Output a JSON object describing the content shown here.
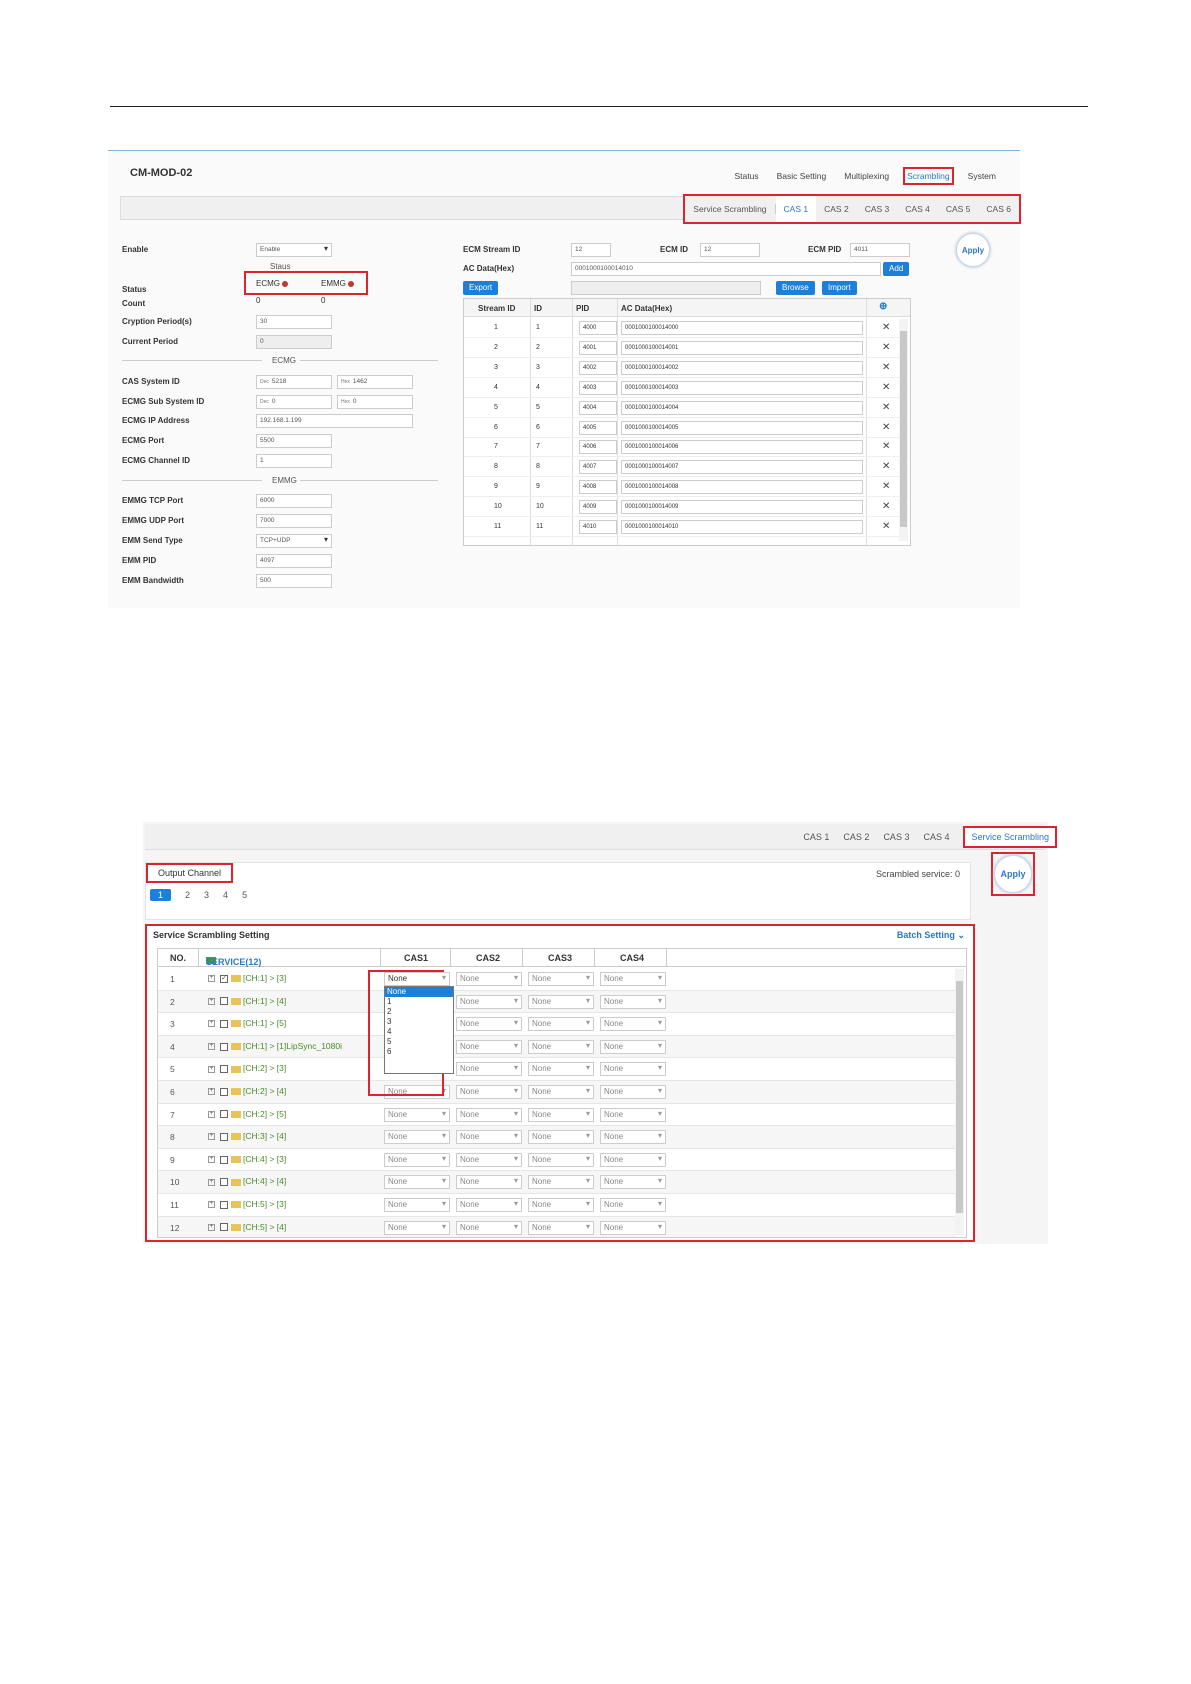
{
  "s1": {
    "title": "CM-MOD-02",
    "nav": [
      "Status",
      "Basic Setting",
      "Multiplexing",
      "Scrambling",
      "System"
    ],
    "nav_active": "Scrambling",
    "subtabs": [
      "Service Scrambling",
      "CAS 1",
      "CAS 2",
      "CAS 3",
      "CAS 4",
      "CAS 5",
      "CAS 6"
    ],
    "subtab_active": "CAS 1",
    "left": {
      "enable_label": "Enable",
      "enable_value": "Enable",
      "staus_heading": "Staus",
      "status_label": "Status",
      "ecmg": "ECMG",
      "emmg": "EMMG",
      "count_label": "Count",
      "count_ecmg": "0",
      "count_emmg": "0",
      "cryption_label": "Cryption Period(s)",
      "cryption_value": "30",
      "current_label": "Current Period",
      "current_value": "0",
      "ecmg_heading": "ECMG",
      "cas_sys_label": "CAS System ID",
      "dec_prefix": "Dec",
      "hex_prefix": "Hex",
      "cas_sys_dec": "5218",
      "cas_sys_hex": "1462",
      "ecmg_sub_label": "ECMG Sub System ID",
      "ecmg_sub_dec": "0",
      "ecmg_sub_hex": "0",
      "ecmg_ip_label": "ECMG IP Address",
      "ecmg_ip": "192.168.1.199",
      "ecmg_port_label": "ECMG Port",
      "ecmg_port": "5500",
      "ecmg_ch_label": "ECMG Channel ID",
      "ecmg_ch": "1",
      "emmg_heading": "EMMG",
      "emmg_tcp_label": "EMMG TCP Port",
      "emmg_tcp": "6000",
      "emmg_udp_label": "EMMG UDP Port",
      "emmg_udp": "7000",
      "emm_send_label": "EMM Send Type",
      "emm_send": "TCP+UDP",
      "emm_pid_label": "EMM PID",
      "emm_pid": "4097",
      "emm_bw_label": "EMM Bandwidth",
      "emm_bw": "500"
    },
    "right": {
      "ecm_stream_label": "ECM Stream ID",
      "ecm_stream": "12",
      "ecm_id_label": "ECM ID",
      "ecm_id": "12",
      "ecm_pid_label": "ECM PID",
      "ecm_pid": "4011",
      "ac_label": "AC Data(Hex)",
      "ac_value": "0001000100014010",
      "add": "Add",
      "export": "Export",
      "browse": "Browse",
      "import": "Import",
      "apply": "Apply",
      "col_stream": "Stream ID",
      "col_id": "ID",
      "col_pid": "PID",
      "col_ac": "AC Data(Hex)"
    },
    "rows": [
      {
        "sid": "1",
        "id": "1",
        "pid": "4000",
        "ac": "0001000100014000"
      },
      {
        "sid": "2",
        "id": "2",
        "pid": "4001",
        "ac": "0001000100014001"
      },
      {
        "sid": "3",
        "id": "3",
        "pid": "4002",
        "ac": "0001000100014002"
      },
      {
        "sid": "4",
        "id": "4",
        "pid": "4003",
        "ac": "0001000100014003"
      },
      {
        "sid": "5",
        "id": "5",
        "pid": "4004",
        "ac": "0001000100014004"
      },
      {
        "sid": "6",
        "id": "6",
        "pid": "4005",
        "ac": "0001000100014005"
      },
      {
        "sid": "7",
        "id": "7",
        "pid": "4006",
        "ac": "0001000100014006"
      },
      {
        "sid": "8",
        "id": "8",
        "pid": "4007",
        "ac": "0001000100014007"
      },
      {
        "sid": "9",
        "id": "9",
        "pid": "4008",
        "ac": "0001000100014008"
      },
      {
        "sid": "10",
        "id": "10",
        "pid": "4009",
        "ac": "0001000100014009"
      },
      {
        "sid": "11",
        "id": "11",
        "pid": "4010",
        "ac": "0001000100014010"
      }
    ]
  },
  "s2": {
    "tabs": [
      "CAS 1",
      "CAS 2",
      "CAS 3",
      "CAS 4"
    ],
    "active_tab": "Service Scrambling",
    "output_channel": "Output Channel",
    "pages": [
      "1",
      "2",
      "3",
      "4",
      "5"
    ],
    "scrambled": "Scrambled service: 0",
    "apply": "Apply",
    "section_title": "Service Scrambling Setting",
    "batch": "Batch Setting",
    "col_no": "NO.",
    "col_service": "SERVICE(12)",
    "cas_cols": [
      "CAS1",
      "CAS2",
      "CAS3",
      "CAS4"
    ],
    "none": "None",
    "popup_options": [
      "None",
      "1",
      "2",
      "3",
      "4",
      "5",
      "6"
    ],
    "rows": [
      {
        "no": "1",
        "name": "[CH:1] > [3]",
        "checked": true
      },
      {
        "no": "2",
        "name": "[CH:1] > [4]",
        "checked": false
      },
      {
        "no": "3",
        "name": "[CH:1] > [5]",
        "checked": false
      },
      {
        "no": "4",
        "name": "[CH:1] > [1]LipSync_1080i",
        "checked": false
      },
      {
        "no": "5",
        "name": "[CH:2] > [3]",
        "checked": false
      },
      {
        "no": "6",
        "name": "[CH:2] > [4]",
        "checked": false
      },
      {
        "no": "7",
        "name": "[CH:2] > [5]",
        "checked": false
      },
      {
        "no": "8",
        "name": "[CH:3] > [4]",
        "checked": false
      },
      {
        "no": "9",
        "name": "[CH:4] > [3]",
        "checked": false
      },
      {
        "no": "10",
        "name": "[CH:4] > [4]",
        "checked": false
      },
      {
        "no": "11",
        "name": "[CH:5] > [3]",
        "checked": false
      },
      {
        "no": "12",
        "name": "[CH:5] > [4]",
        "checked": false
      }
    ]
  }
}
